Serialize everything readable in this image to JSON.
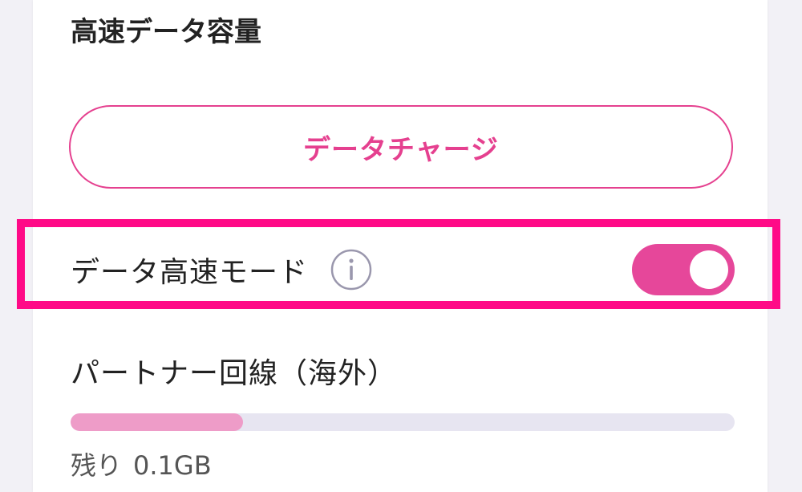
{
  "section": {
    "title": "高速データ容量"
  },
  "charge_button": {
    "label": "データチャージ"
  },
  "speed_mode": {
    "label": "データ高速モード",
    "info_icon": "info-circle-icon",
    "toggle_on": true
  },
  "partner_line": {
    "label": "パートナー回線（海外）",
    "usage_fraction": 0.26,
    "remaining_label": "残り",
    "remaining_value": "0.1GB"
  },
  "colors": {
    "accent": "#e5408f",
    "toggle_on": "#e6479a",
    "highlight": "#ff0a87",
    "progress_fill": "#ee9cc8",
    "progress_track": "#e7e5f1"
  }
}
